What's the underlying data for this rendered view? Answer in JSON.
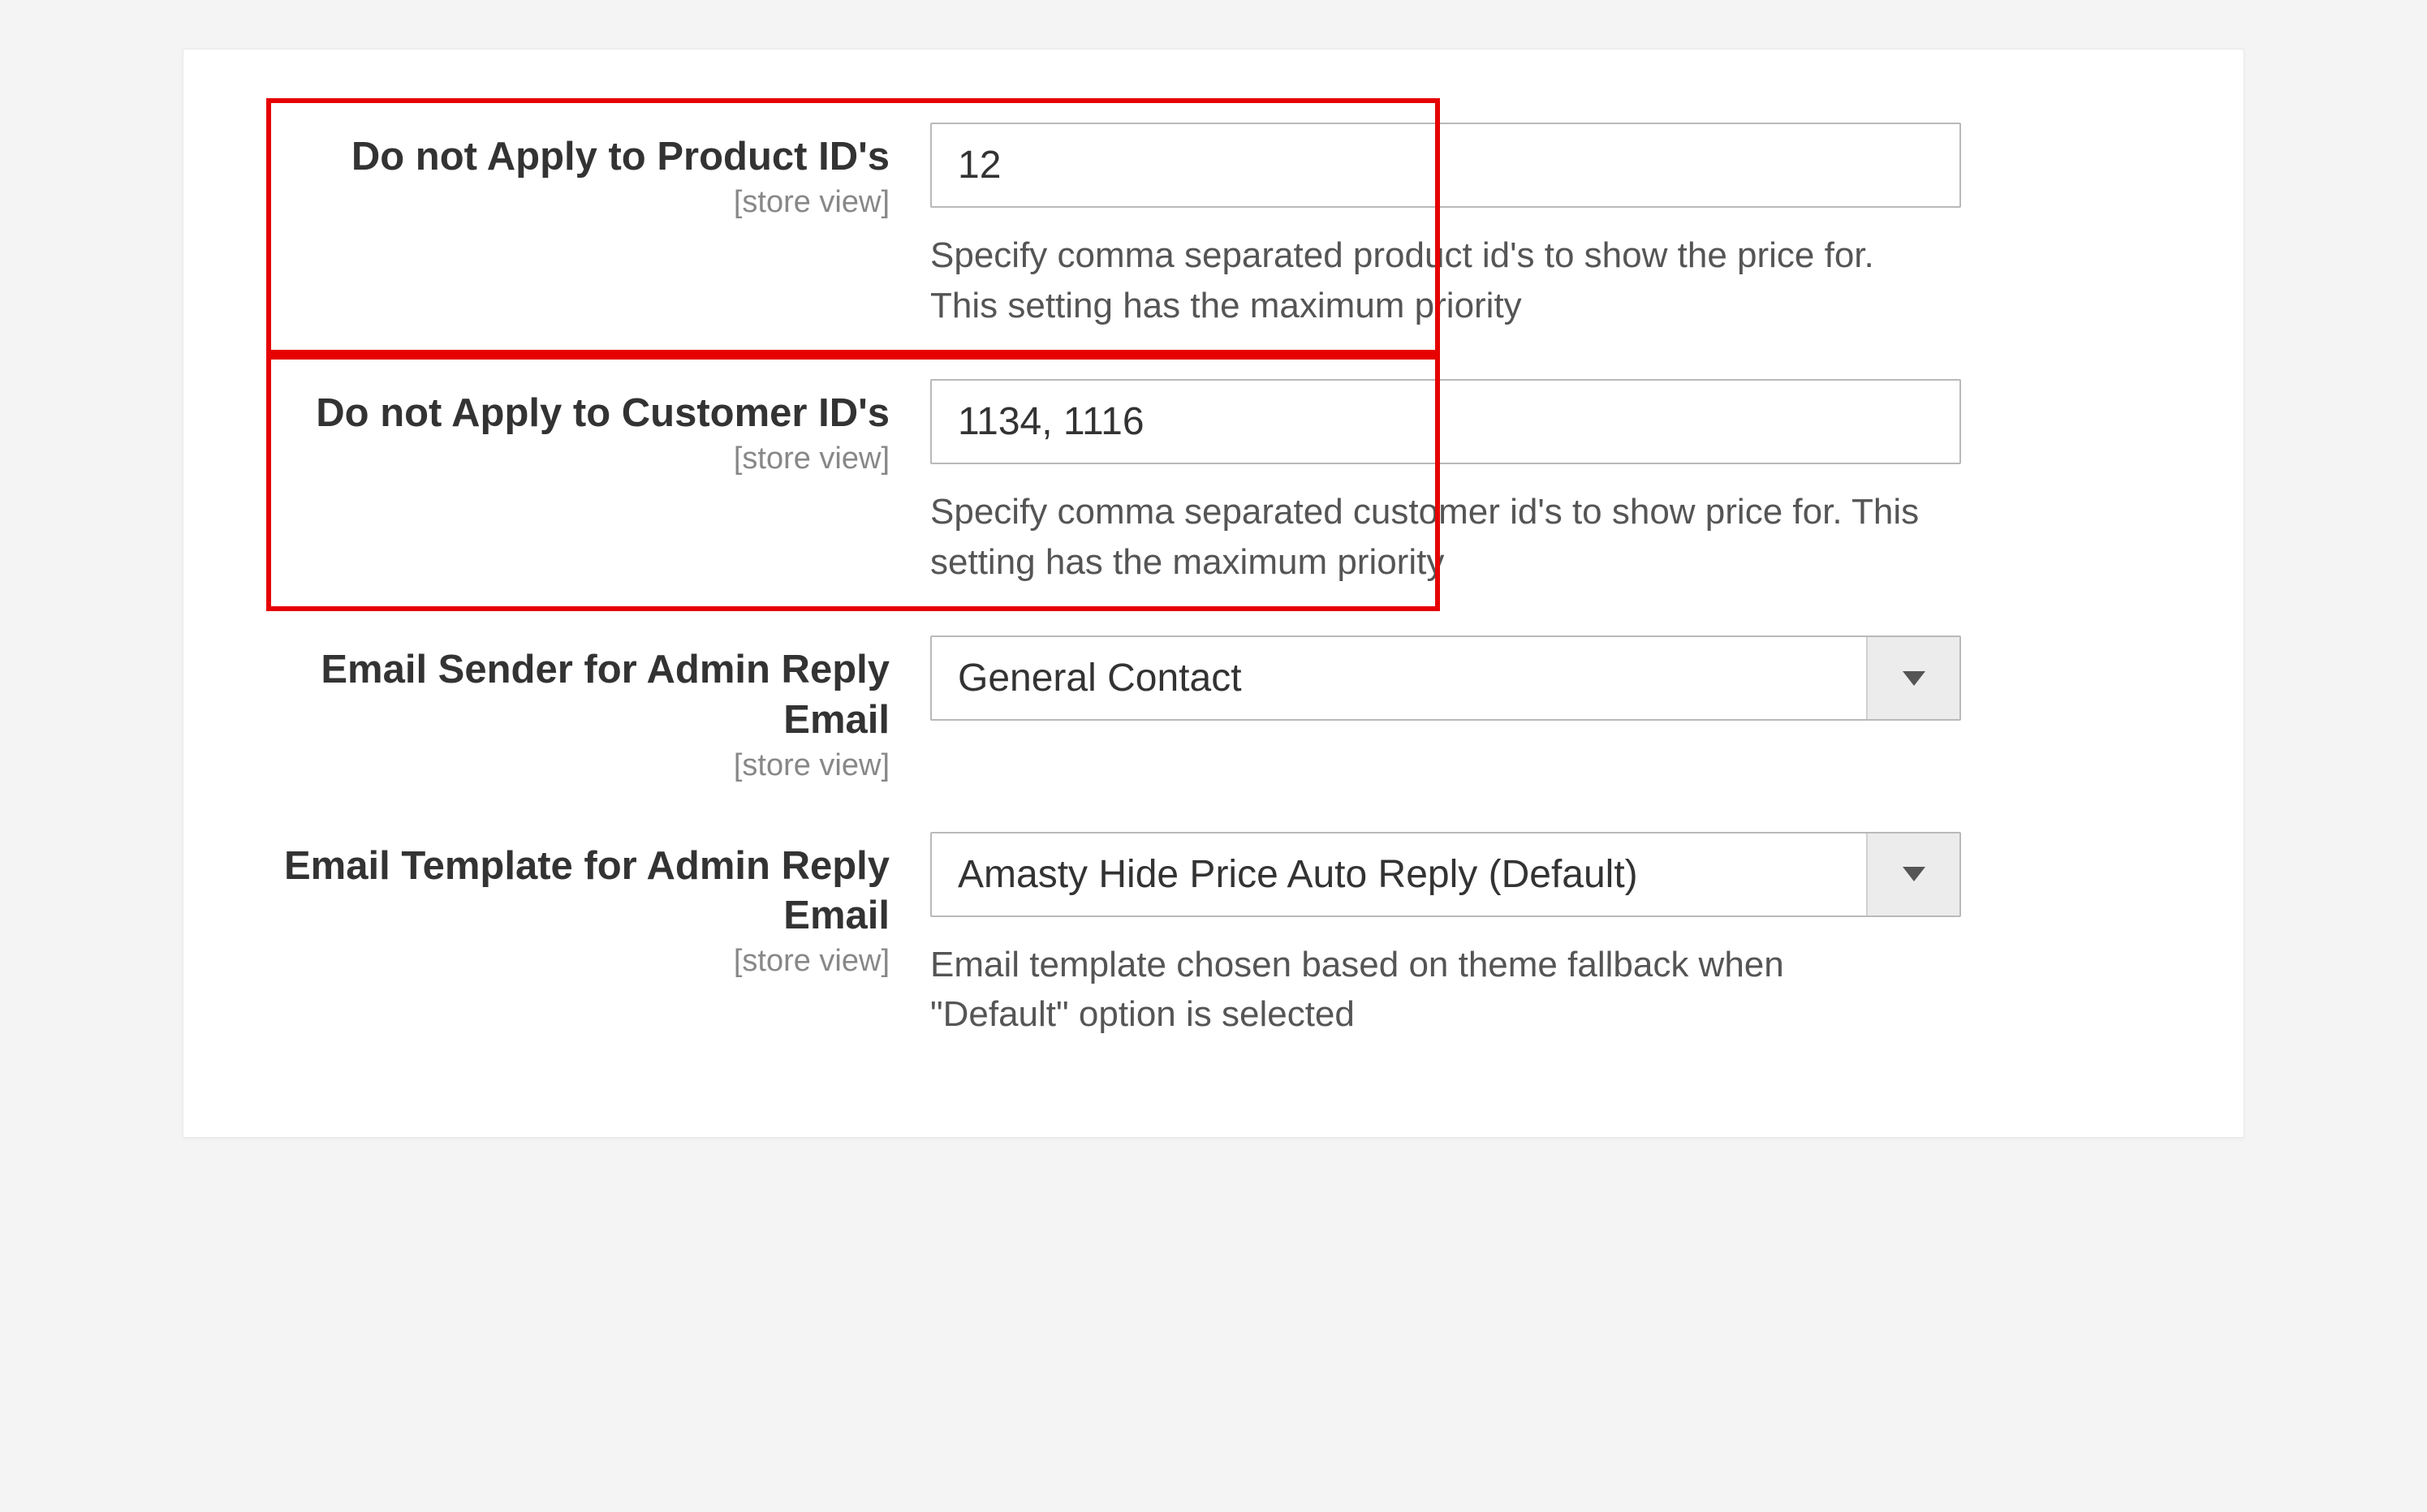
{
  "fields": {
    "product_ids": {
      "label": "Do not Apply to Product ID's",
      "scope": "[store view]",
      "value": "12",
      "note": "Specify comma separated product id's to show the price for. This setting has the maximum priority"
    },
    "customer_ids": {
      "label": "Do not Apply to Customer ID's",
      "scope": "[store view]",
      "value": "1134, 1116",
      "note": "Specify comma separated customer id's to show price for. This setting has the maximum priority"
    },
    "email_sender": {
      "label": "Email Sender for Admin Reply Email",
      "scope": "[store view]",
      "selected": "General Contact"
    },
    "email_template": {
      "label": "Email Template for Admin Reply Email",
      "scope": "[store view]",
      "selected": "Amasty Hide Price Auto Reply (Default)",
      "note": "Email template chosen based on theme fallback when \"Default\" option is selected"
    }
  }
}
